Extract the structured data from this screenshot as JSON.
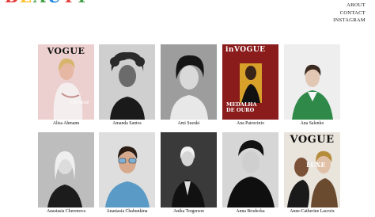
{
  "logo": {
    "text": "BEAUTY"
  },
  "nav": [
    {
      "label": "ABOUT"
    },
    {
      "label": "CONTACT"
    },
    {
      "label": "INSTAGRAM"
    }
  ],
  "models": [
    {
      "name": "Alisa Ahmann",
      "magazine": "VOGUE",
      "cover_text": "Chinese"
    },
    {
      "name": "Amanda Santos"
    },
    {
      "name": "Ami Suzuki"
    },
    {
      "name": "Ana Patrocinio",
      "magazine": "inVOGUE",
      "cover_text": "MEDALHA DE OURO"
    },
    {
      "name": "Ana Salenko"
    },
    {
      "name": "Anastasia Cherenova"
    },
    {
      "name": "Anastasia Chabunkina"
    },
    {
      "name": "Anika Torgerson"
    },
    {
      "name": "Anna Brodecka"
    },
    {
      "name": "Anne-Catherine Lacroix",
      "magazine": "VOGUE",
      "cover_text": "LUXE"
    }
  ],
  "colors": {
    "cover1_bg": "#e9c9c9",
    "cover4_bg": "#d8a12a",
    "green_sweater": "#2f8a4a",
    "denim": "#5a9ac6"
  }
}
